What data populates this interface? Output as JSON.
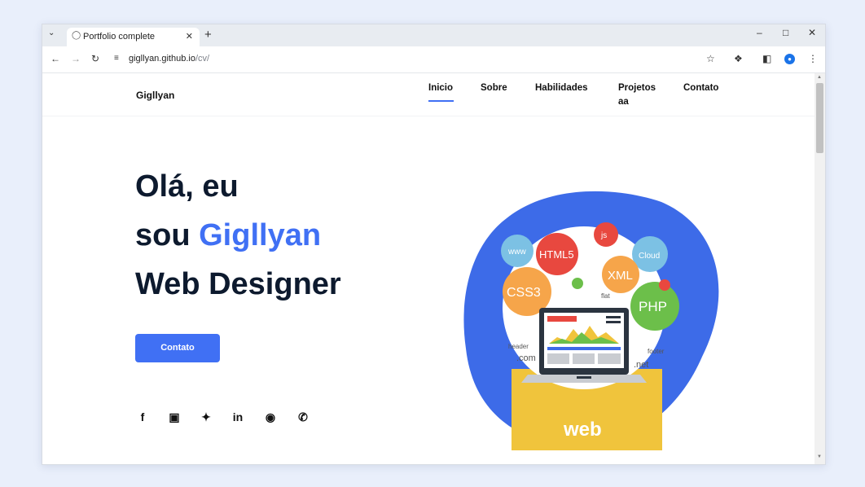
{
  "browser": {
    "tab_title": "Portfolio complete",
    "address_host": "gigllyan.github.io",
    "address_path": "/cv/"
  },
  "site": {
    "logo": "Gigllyan",
    "nav": [
      {
        "label": "Inicio",
        "active": true
      },
      {
        "label": "Sobre"
      },
      {
        "label": "Habilidades"
      },
      {
        "label": "Projetos aa"
      },
      {
        "label": "Contato"
      }
    ],
    "hero": {
      "line1": "Olá, eu",
      "line2_prefix": "sou ",
      "line2_name": "Gigllyan",
      "line3": "Web Designer"
    },
    "cta_label": "Contato",
    "social_icons": [
      "facebook-icon",
      "instagram-icon",
      "twitter-icon",
      "linkedin-icon",
      "github-icon",
      "whatsapp-icon"
    ],
    "illustration": {
      "bubbles": [
        "HTML5",
        "js",
        "Cloud",
        "XML",
        "CSS3",
        "PHP",
        "www",
        "flat",
        "header",
        ".com",
        ".net",
        "footer"
      ],
      "banner": "web"
    },
    "colors": {
      "accent": "#4070f4",
      "blob": "#3d6be8",
      "banner": "#f0c43c"
    }
  }
}
